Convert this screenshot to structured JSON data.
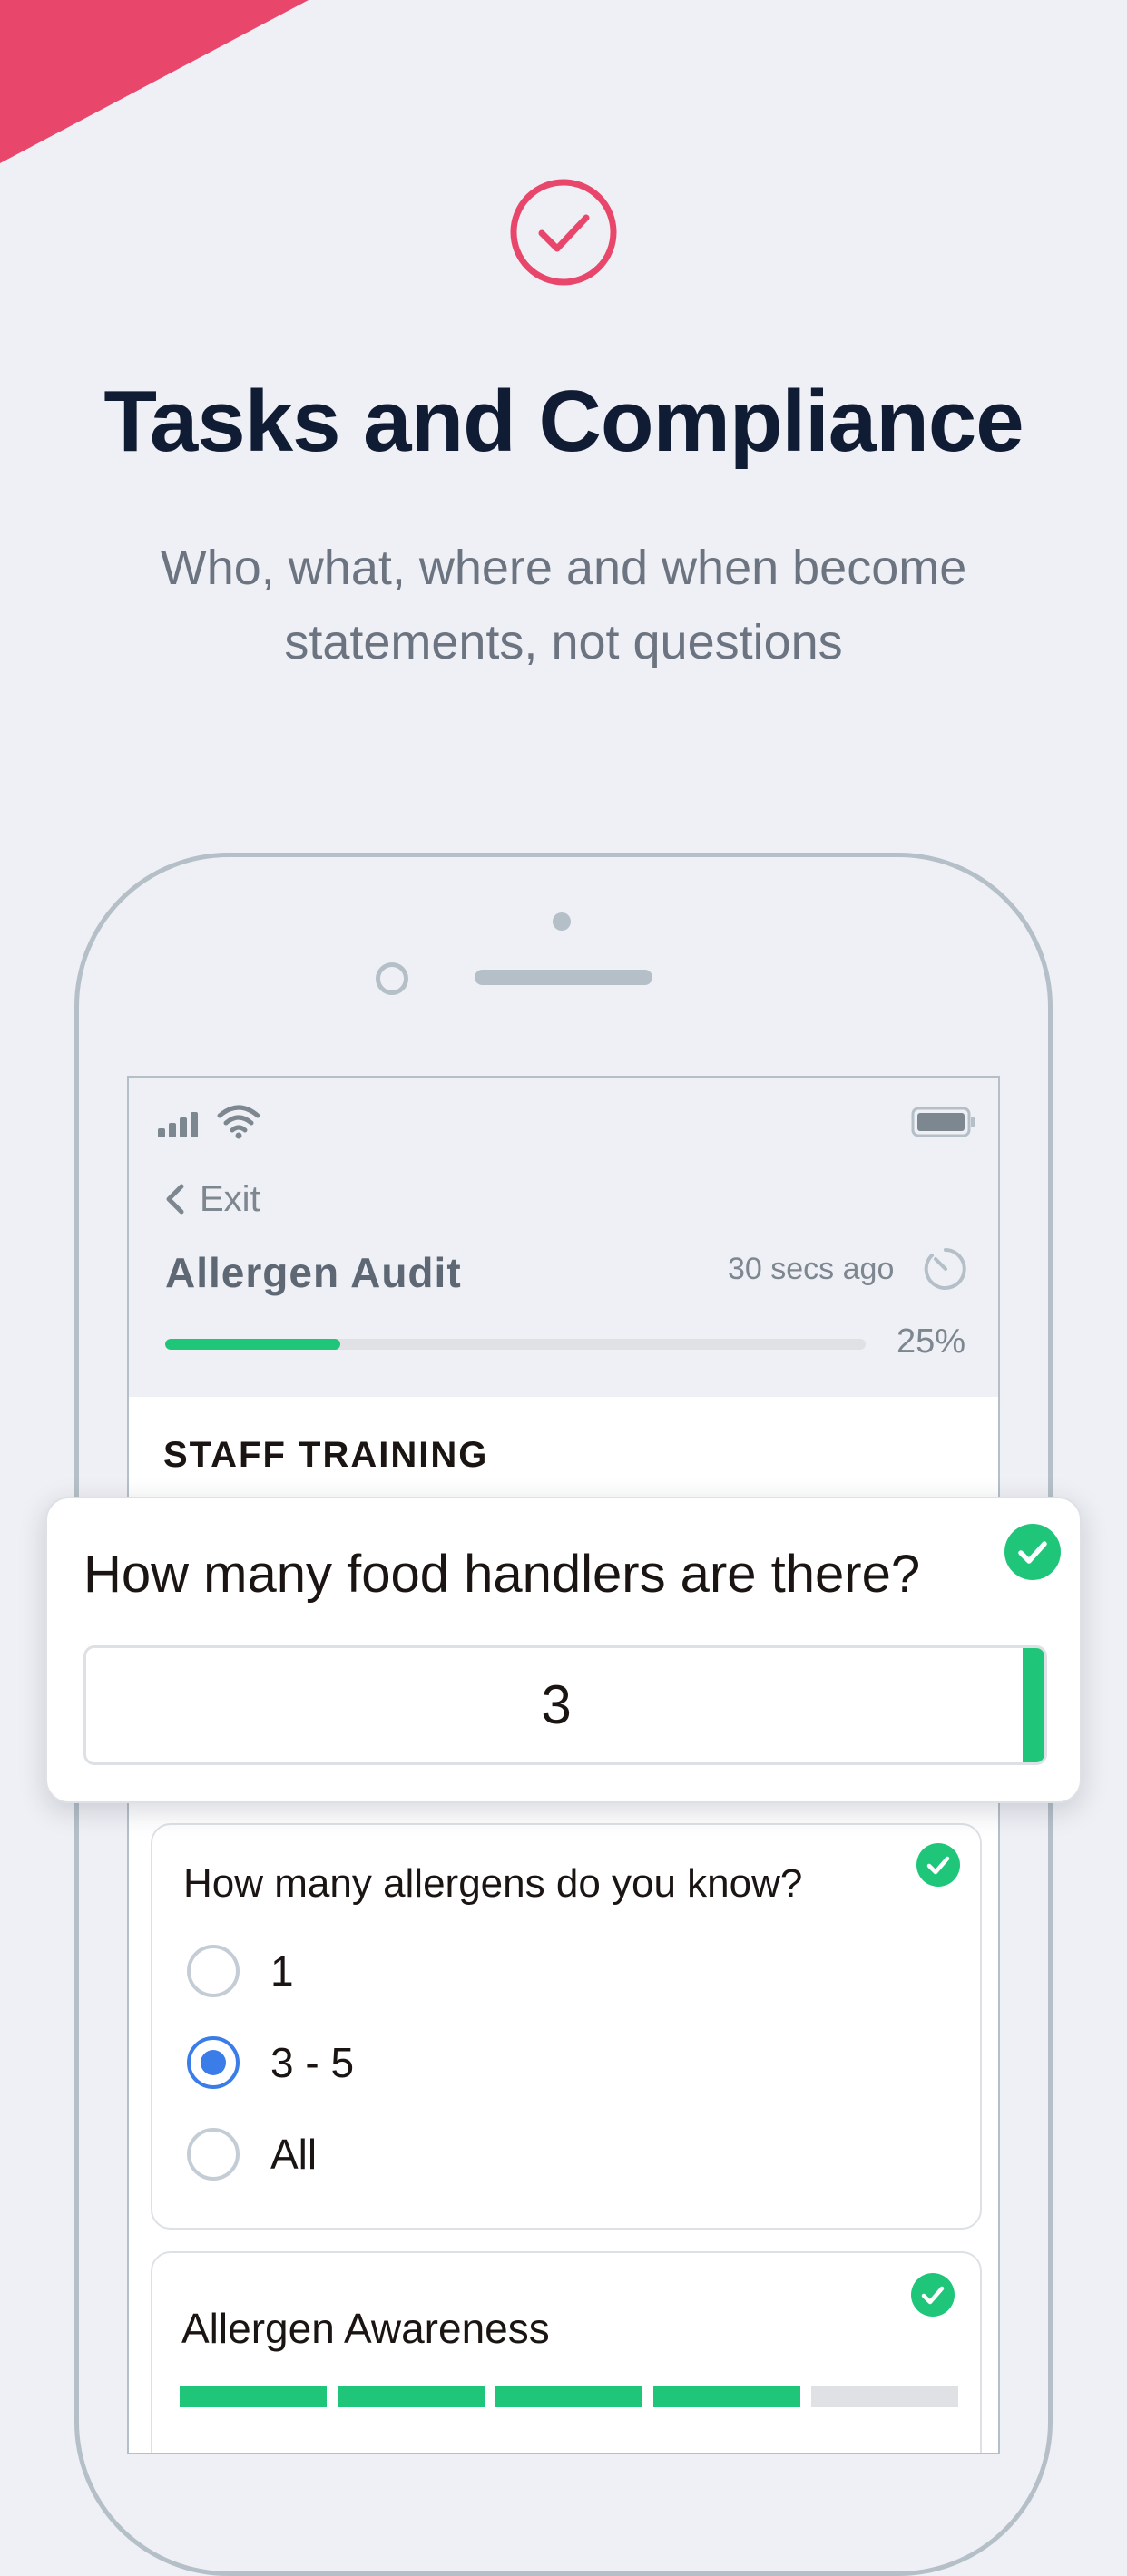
{
  "marketing": {
    "title": "Tasks and Compliance",
    "subtitle_line1": "Who, what, where and when become",
    "subtitle_line2": "statements, not questions",
    "accent_color": "#e8466b",
    "hero_icon": "check-circle-icon"
  },
  "app": {
    "status_bar": {
      "signal_icon": "signal-icon",
      "wifi_icon": "wifi-icon",
      "battery_icon": "battery-icon"
    },
    "exit_label": "Exit",
    "audit_title": "Allergen Audit",
    "last_saved": "30 secs ago",
    "progress": {
      "value": 0.25,
      "label": "25%"
    },
    "section_title": "STAFF TRAINING",
    "questions": [
      {
        "text": "How many food handlers are there?",
        "answer": "3",
        "answered": true
      },
      {
        "text": "How many allergens do you know?",
        "options": [
          {
            "label": "1",
            "selected": false
          },
          {
            "label": "3 - 5",
            "selected": true
          },
          {
            "label": "All",
            "selected": false
          }
        ],
        "answered": true
      },
      {
        "text": "Allergen Awareness",
        "segments_total": 5,
        "segments_filled": 4,
        "answered": true
      }
    ],
    "colors": {
      "success": "#1fc67a",
      "selected": "#3b7de8",
      "muted": "#7d8790"
    }
  }
}
